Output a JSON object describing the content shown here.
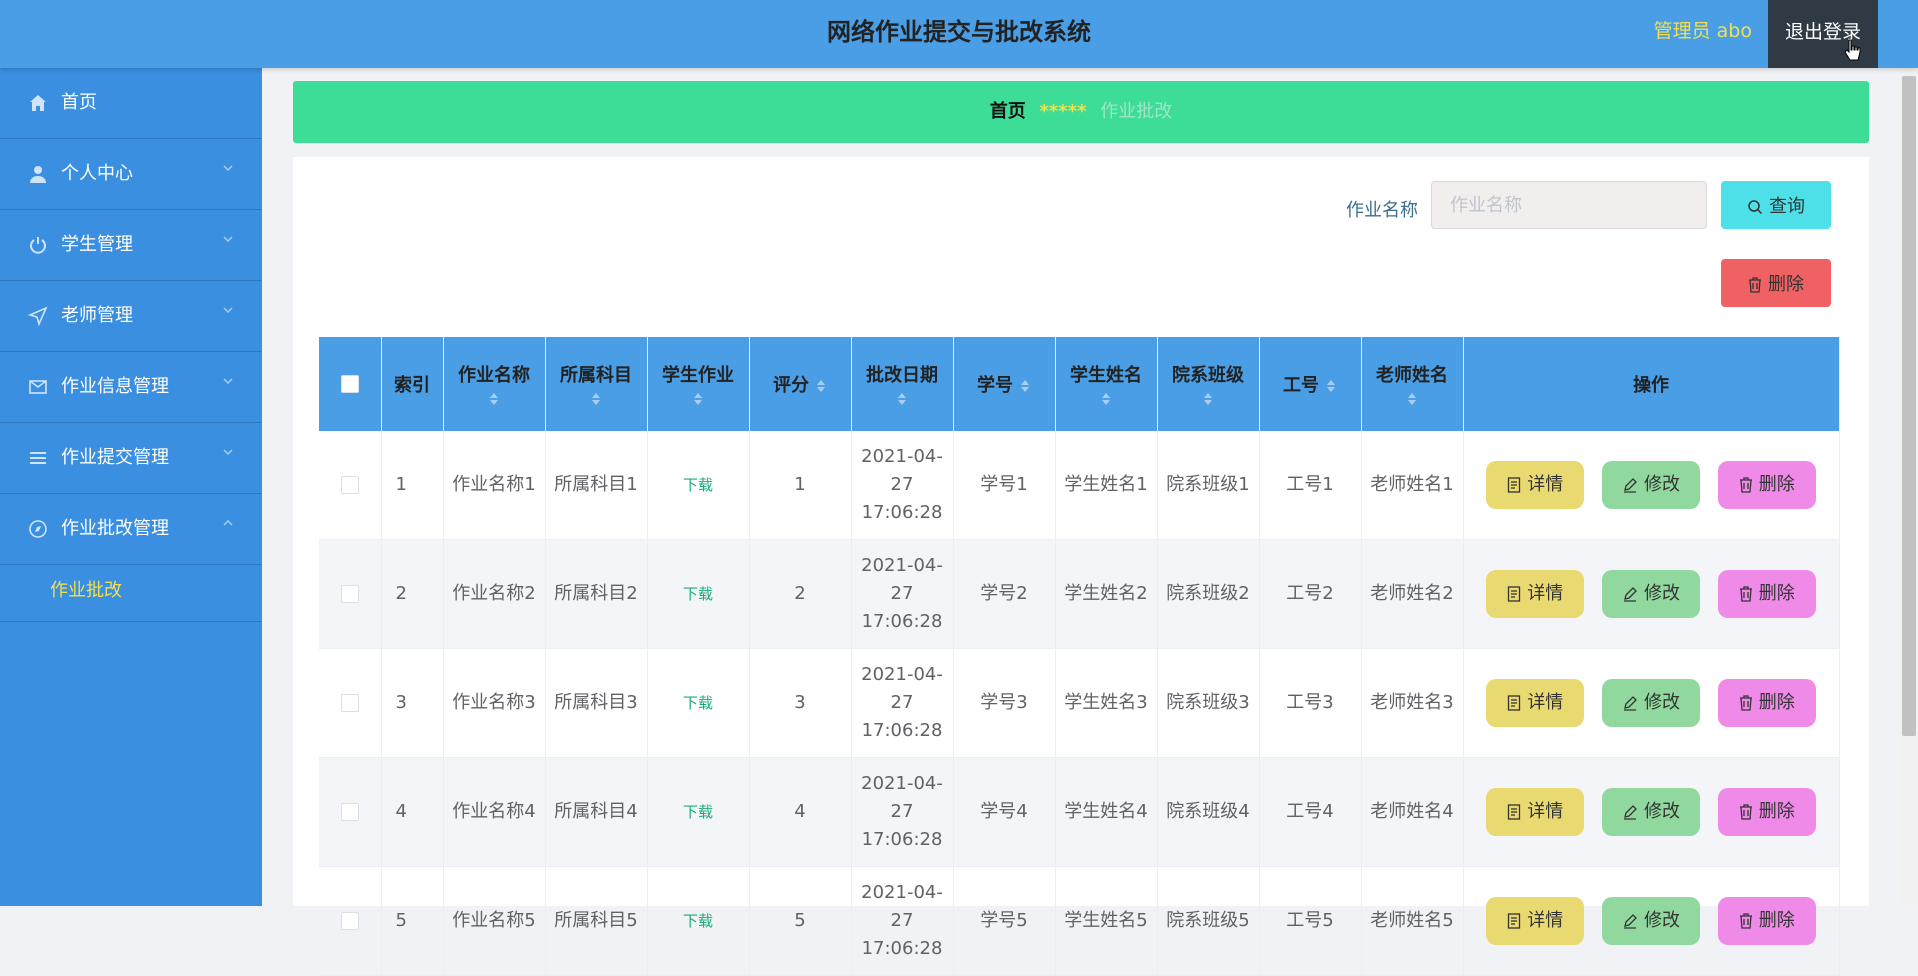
{
  "header": {
    "title": "网络作业提交与批改系统",
    "admin_label": "管理员 abo",
    "logout_label": "退出登录"
  },
  "sidebar": {
    "items": [
      {
        "label": "首页",
        "icon": "home-icon"
      },
      {
        "label": "个人中心",
        "icon": "user-icon"
      },
      {
        "label": "学生管理",
        "icon": "power-icon"
      },
      {
        "label": "老师管理",
        "icon": "send-icon"
      },
      {
        "label": "作业信息管理",
        "icon": "mail-icon"
      },
      {
        "label": "作业提交管理",
        "icon": "list-icon"
      },
      {
        "label": "作业批改管理",
        "icon": "compass-icon"
      }
    ],
    "submenu_item": "作业批改"
  },
  "breadcrumb": {
    "home": "首页",
    "separator": "*****",
    "current": "作业批改"
  },
  "search": {
    "label": "作业名称",
    "placeholder": "作业名称",
    "query_label": "查询",
    "delete_label": "删除"
  },
  "table": {
    "columns": [
      "索引",
      "作业名称",
      "所属科目",
      "学生作业",
      "评分",
      "批改日期",
      "学号",
      "学生姓名",
      "院系班级",
      "工号",
      "老师姓名",
      "操作"
    ],
    "rows": [
      {
        "index": "1",
        "name": "作业名称1",
        "subject": "所属科目1",
        "homework": "下载",
        "score": "1",
        "date": "2021-04-27 17:06:28",
        "student_no": "学号1",
        "student_name": "学生姓名1",
        "class": "院系班级1",
        "teacher_no": "工号1",
        "teacher_name": "老师姓名1"
      },
      {
        "index": "2",
        "name": "作业名称2",
        "subject": "所属科目2",
        "homework": "下载",
        "score": "2",
        "date": "2021-04-27 17:06:28",
        "student_no": "学号2",
        "student_name": "学生姓名2",
        "class": "院系班级2",
        "teacher_no": "工号2",
        "teacher_name": "老师姓名2"
      },
      {
        "index": "3",
        "name": "作业名称3",
        "subject": "所属科目3",
        "homework": "下载",
        "score": "3",
        "date": "2021-04-27 17:06:28",
        "student_no": "学号3",
        "student_name": "学生姓名3",
        "class": "院系班级3",
        "teacher_no": "工号3",
        "teacher_name": "老师姓名3"
      },
      {
        "index": "4",
        "name": "作业名称4",
        "subject": "所属科目4",
        "homework": "下载",
        "score": "4",
        "date": "2021-04-27 17:06:28",
        "student_no": "学号4",
        "student_name": "学生姓名4",
        "class": "院系班级4",
        "teacher_no": "工号4",
        "teacher_name": "老师姓名4"
      },
      {
        "index": "5",
        "name": "作业名称5",
        "subject": "所属科目5",
        "homework": "下载",
        "score": "5",
        "date": "2021-04-27 17:06:28",
        "student_no": "学号5",
        "student_name": "学生姓名5",
        "class": "院系班级5",
        "teacher_no": "工号5",
        "teacher_name": "老师姓名5"
      }
    ],
    "actions": {
      "detail": "详情",
      "edit": "修改",
      "delete": "删除"
    }
  },
  "colors": {
    "header_bg": "#4a9ee6",
    "sidebar_bg": "#3a8fe0",
    "breadcrumb_bg": "#3ddc97",
    "detail_btn": "#e9d971",
    "edit_btn": "#90d89e",
    "delete_btn": "#ef8ae8",
    "query_btn": "#4ee0e8",
    "delete_top_btn": "#ef6163"
  }
}
